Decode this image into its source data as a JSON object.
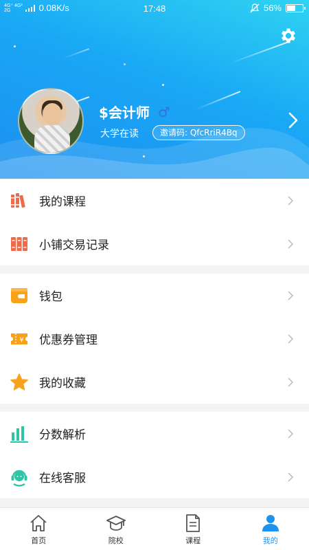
{
  "status_bar": {
    "network_top": "4G⁺ 4G²",
    "network_bottom": "2G",
    "speed": "0.08K/s",
    "time": "17:48",
    "battery": "56%",
    "battery_level": 0.56
  },
  "profile": {
    "name": "$会计师",
    "gender_icon": "male-icon",
    "gender_symbol": "♂",
    "status": "大学在读",
    "invite_label": "邀请码: QfcRriR4Bq"
  },
  "menu": {
    "groups": [
      [
        {
          "label": "我的课程",
          "icon": "books-icon",
          "color": "#ef6a4a"
        },
        {
          "label": "小铺交易记录",
          "icon": "ledger-icon",
          "color": "#ef6a4a"
        }
      ],
      [
        {
          "label": "钱包",
          "icon": "wallet-icon",
          "color": "#f7a21a"
        },
        {
          "label": "优惠券管理",
          "icon": "coupon-icon",
          "color": "#f7a21a"
        },
        {
          "label": "我的收藏",
          "icon": "star-icon",
          "color": "#f7a21a"
        }
      ],
      [
        {
          "label": "分数解析",
          "icon": "bar-chart-icon",
          "color": "#2ec4a6"
        },
        {
          "label": "在线客服",
          "icon": "headset-icon",
          "color": "#2ec4a6"
        }
      ]
    ]
  },
  "tabbar": {
    "tabs": [
      {
        "label": "首页",
        "icon": "home-icon"
      },
      {
        "label": "院校",
        "icon": "graduation-cap-icon"
      },
      {
        "label": "课程",
        "icon": "document-icon"
      },
      {
        "label": "我的",
        "icon": "user-icon",
        "active": true
      }
    ]
  },
  "colors": {
    "accent": "#1d93f0",
    "header_top": "#2fd3f2",
    "header_bottom": "#1b8ff0"
  }
}
